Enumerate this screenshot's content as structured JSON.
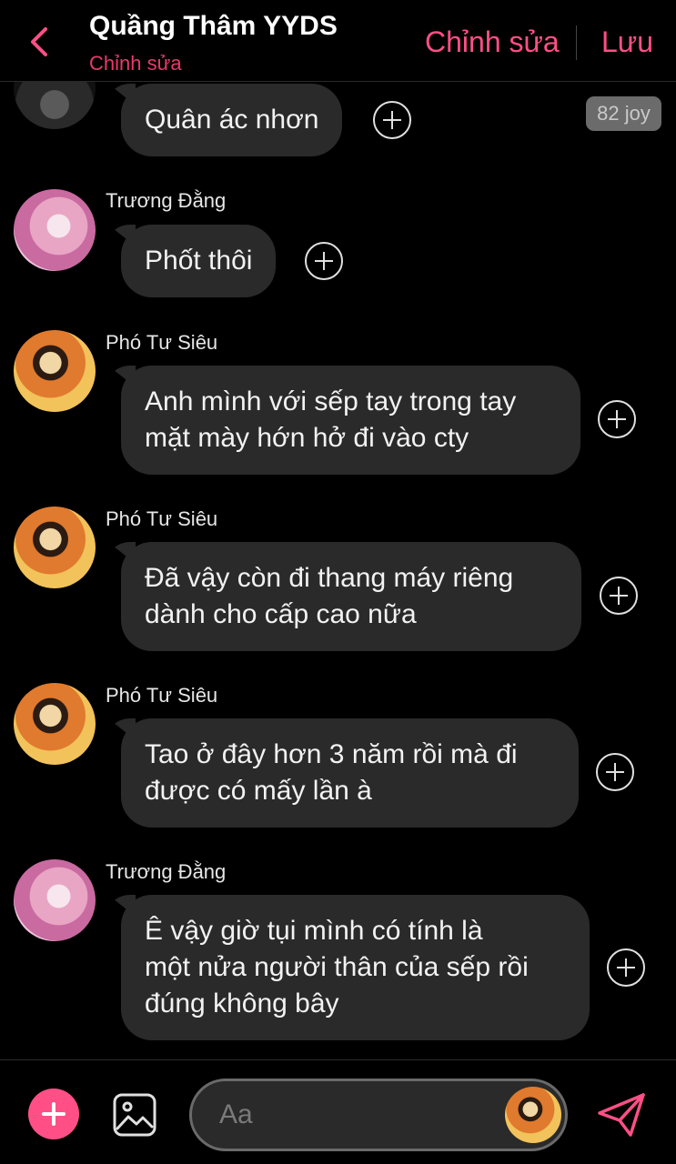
{
  "header": {
    "title": "Quầng Thâm YYDS",
    "subtitle": "Chỉnh sửa",
    "edit_label": "Chỉnh sửa",
    "save_label": "Lưu"
  },
  "messages": [
    {
      "sender": "",
      "text": "Quân ác nhơn",
      "badge": "82 joy"
    },
    {
      "sender": "Trương Đằng",
      "text": "Phốt thôi"
    },
    {
      "sender": "Phó Tư Siêu",
      "text": "Anh mình với sếp tay trong tay\nmặt mày hớn hở đi vào cty"
    },
    {
      "sender": "Phó Tư Siêu",
      "text": "Đã vậy còn đi thang máy riêng\ndành cho cấp cao nữa"
    },
    {
      "sender": "Phó Tư Siêu",
      "text": "Tao ở đây hơn 3 năm rồi mà đi\nđược có mấy lần à"
    },
    {
      "sender": "Trương Đằng",
      "text": "Ê vậy giờ tụi mình có tính là\nmột nửa người thân của sếp rồi\nđúng không bây"
    }
  ],
  "composer": {
    "placeholder": "Aa"
  },
  "colors": {
    "accent": "#ff4f86",
    "bubble": "#2a2a2a",
    "background": "#000000"
  }
}
